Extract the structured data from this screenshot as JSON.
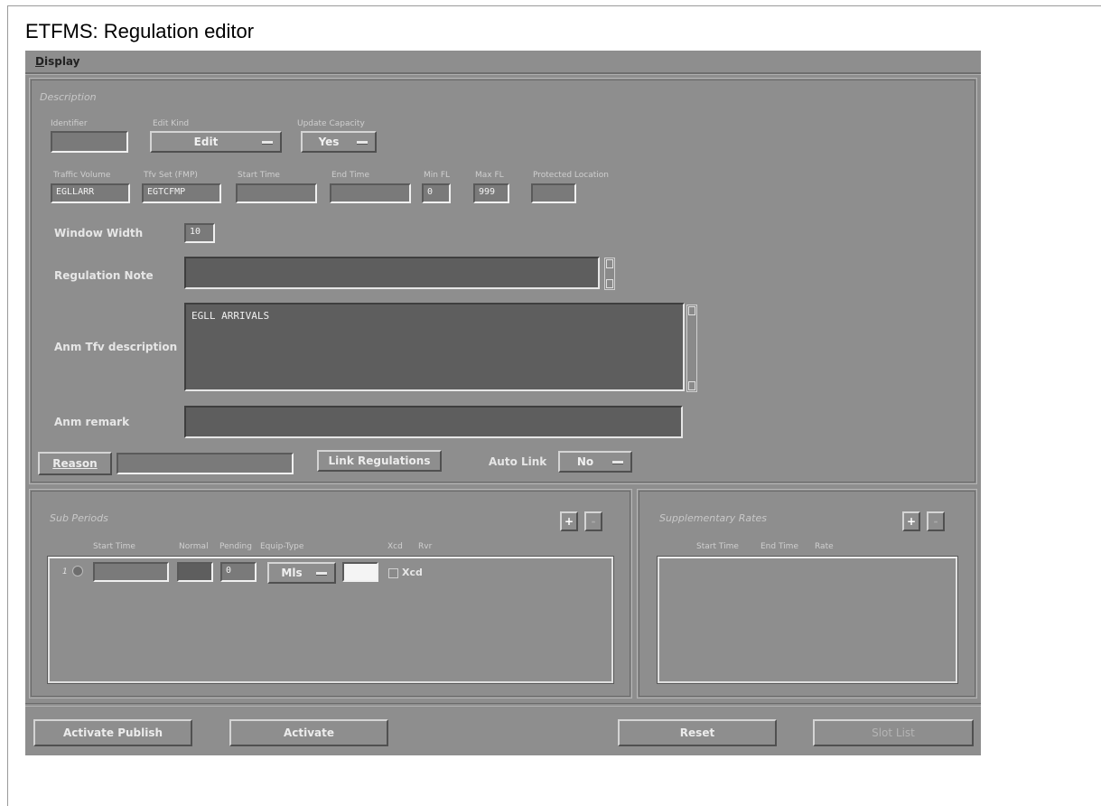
{
  "window": {
    "title": "ETFMS: Regulation editor"
  },
  "menu": {
    "display": "Display"
  },
  "description": {
    "section_title": "Description",
    "identifier": {
      "label": "Identifier",
      "value": ""
    },
    "edit_kind": {
      "label": "Edit Kind",
      "value": "Edit"
    },
    "update_capacity": {
      "label": "Update Capacity",
      "value": "Yes"
    },
    "traffic_volume": {
      "label": "Traffic Volume",
      "value": "EGLLARR"
    },
    "tfv_set": {
      "label": "Tfv Set (FMP)",
      "value": "EGTCFMP"
    },
    "start_time": {
      "label": "Start Time",
      "value": ""
    },
    "end_time": {
      "label": "End Time",
      "value": ""
    },
    "min_fl": {
      "label": "Min FL",
      "value": "0"
    },
    "max_fl": {
      "label": "Max FL",
      "value": "999"
    },
    "protected_location": {
      "label": "Protected Location",
      "value": ""
    },
    "window_width": {
      "label": "Window Width",
      "value": "10"
    },
    "regulation_note": {
      "label": "Regulation Note",
      "value": ""
    },
    "anm_tfv_description": {
      "label": "Anm Tfv description",
      "value": "EGLL ARRIVALS"
    },
    "anm_remark": {
      "label": "Anm remark",
      "value": ""
    },
    "reason_button": "Reason",
    "reason_value": "",
    "link_regulations_button": "Link Regulations",
    "auto_link": {
      "label": "Auto Link",
      "value": "No"
    }
  },
  "sub_periods": {
    "section_title": "Sub Periods",
    "add": "+",
    "remove": "-",
    "columns": [
      "Start Time",
      "Normal",
      "Pending",
      "Equip-Type",
      "Xcd",
      "Rvr"
    ],
    "rows": [
      {
        "index": "1",
        "start_time": "",
        "normal": "",
        "pending": "0",
        "equip_type": "Mls",
        "rvr": "",
        "xcd_label": "Xcd"
      }
    ]
  },
  "supplementary_rates": {
    "section_title": "Supplementary Rates",
    "add": "+",
    "remove": "-",
    "columns": [
      "Start Time",
      "End Time",
      "Rate"
    ]
  },
  "footer": {
    "activate_publish": "Activate Publish",
    "activate": "Activate",
    "reset": "Reset",
    "slot_list": "Slot List"
  }
}
